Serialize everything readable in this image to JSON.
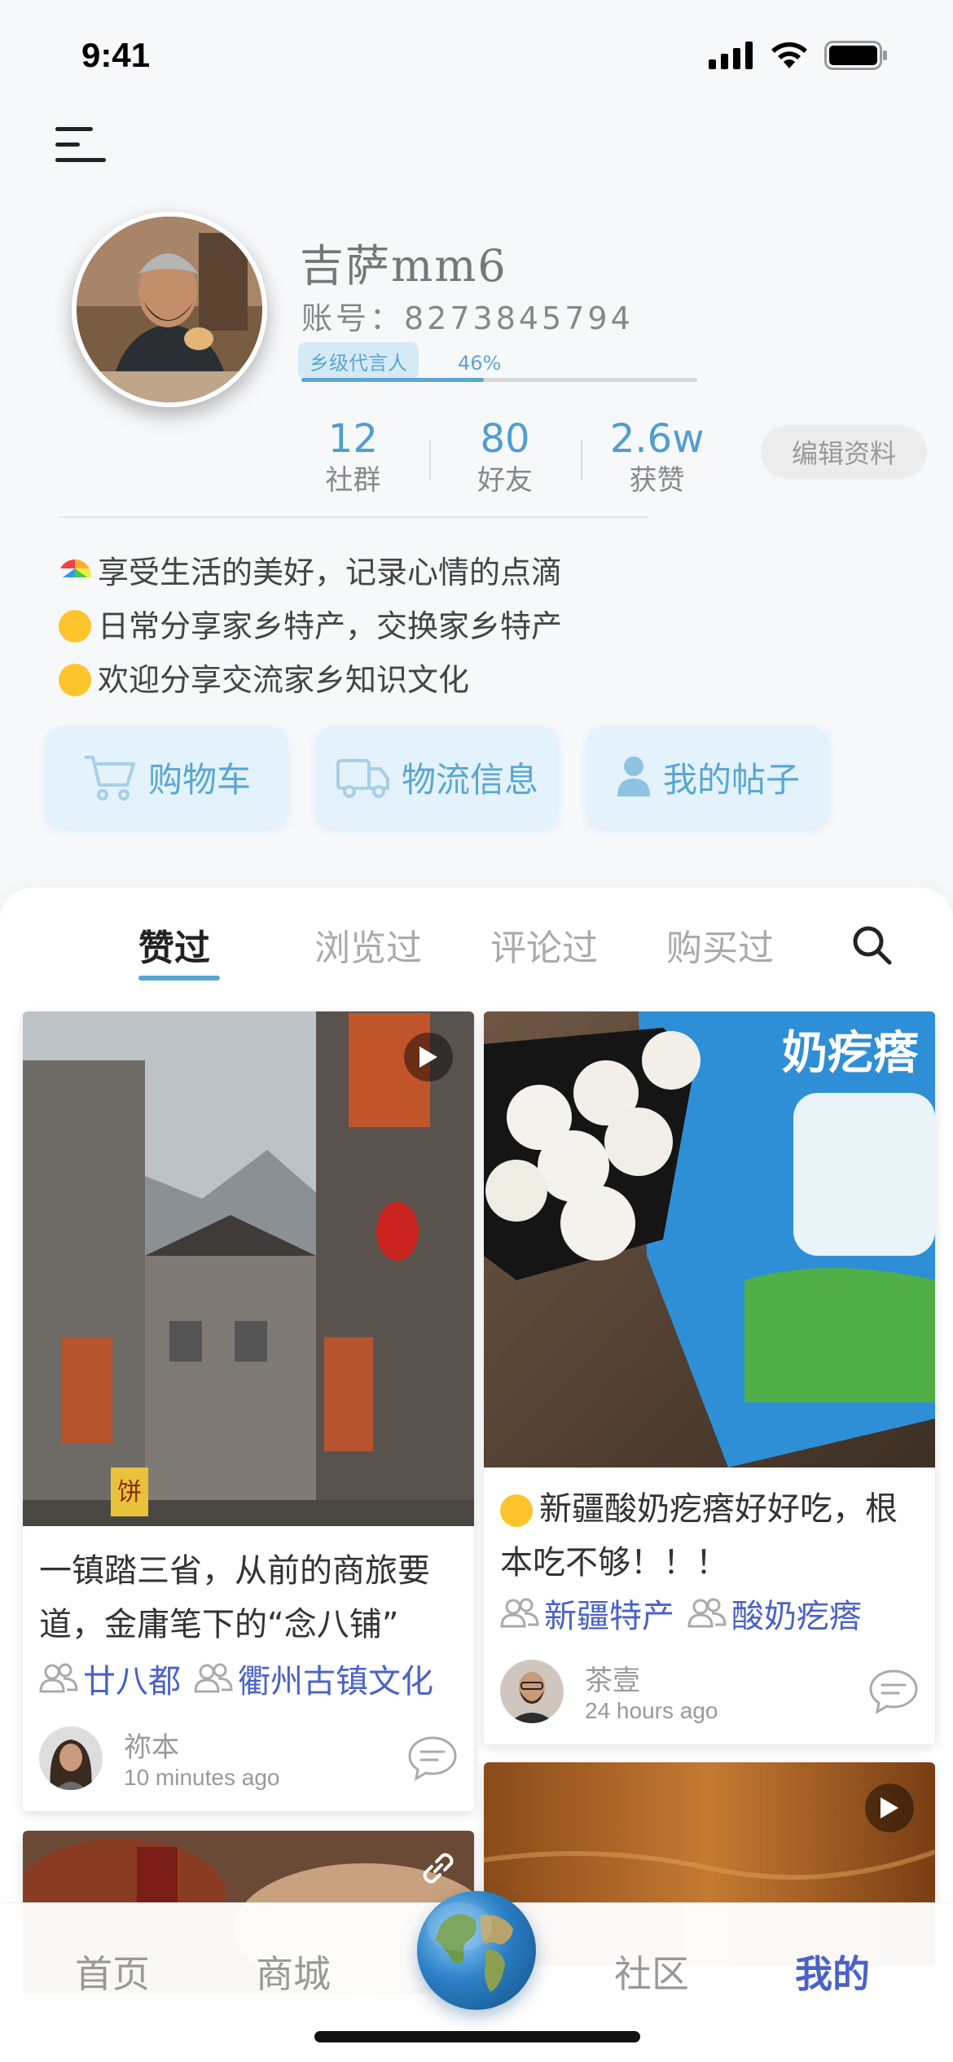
{
  "status_bar": {
    "time": "9:41"
  },
  "profile": {
    "username": "吉萨mm6",
    "account": "账号：8273845794",
    "level_badge": "乡级代言人",
    "level_progress_label": "46%",
    "level_progress_fraction": 0.46,
    "stats": [
      {
        "value": "12",
        "label": "社群"
      },
      {
        "value": "80",
        "label": "好友"
      },
      {
        "value": "2.6w",
        "label": "获赞"
      }
    ],
    "edit_label": "编辑资料",
    "bio": [
      " 享受生活的美好，记录心情的点滴",
      "日常分享家乡特产，交换家乡特产",
      "欢迎分享交流家乡知识文化"
    ]
  },
  "actions": [
    {
      "label": "购物车",
      "icon": "cart-icon"
    },
    {
      "label": "物流信息",
      "icon": "truck-icon"
    },
    {
      "label": "我的帖子",
      "icon": "person-icon"
    }
  ],
  "tabs": [
    {
      "label": "赞过",
      "active": true
    },
    {
      "label": "浏览过",
      "active": false
    },
    {
      "label": "评论过",
      "active": false
    },
    {
      "label": "购买过",
      "active": false
    }
  ],
  "posts": [
    {
      "title": "一镇踏三省，从前的商旅要道，金庸笔下的“念八铺”",
      "tags": [
        "廿八都",
        "衢州古镇文化"
      ],
      "author": "祢本",
      "time": "10 minutes ago",
      "sign_text": "饼"
    },
    {
      "title": "新疆酸奶疙瘩好好吃，根本吃不够！！！",
      "tags": [
        "新疆特产",
        "酸奶疙瘩"
      ],
      "author": "茶壹",
      "time": "24 hours ago",
      "package_text": "奶疙瘩"
    }
  ],
  "bottom_nav": [
    {
      "label": "首页",
      "active": false
    },
    {
      "label": "商城",
      "active": false
    },
    {
      "label": "社区",
      "active": false
    },
    {
      "label": "我的",
      "active": true
    }
  ],
  "colors": {
    "accent": "#5aa6d3",
    "tag_blue": "#4a62c8",
    "action_bg": "#e3f2fb"
  }
}
